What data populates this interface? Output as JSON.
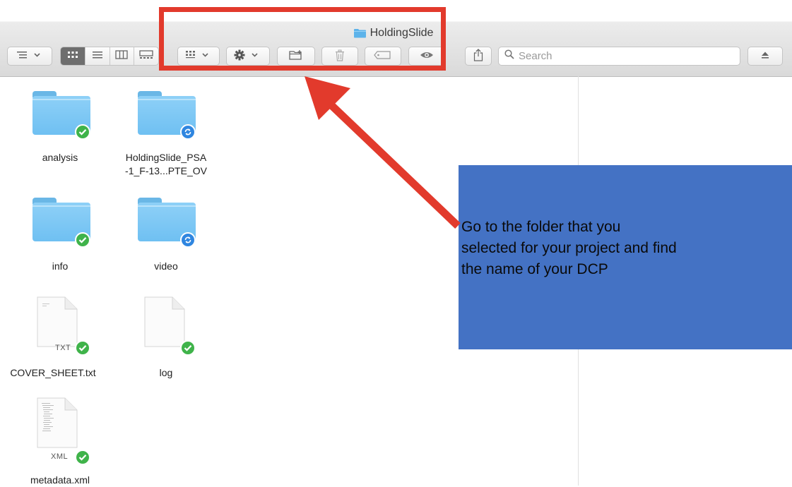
{
  "window": {
    "title": "HoldingSlide"
  },
  "toolbar": {
    "list_dropdown_icon": "list-view-dropdown-icon",
    "view_modes": [
      "icon-view-icon",
      "list-view-icon",
      "column-view-icon",
      "gallery-view-icon"
    ],
    "active_view": "icon-view-icon",
    "group_icon": "group-by-icon",
    "action_icon": "gear-icon",
    "new_folder_icon": "new-folder-icon",
    "delete_icon": "trash-icon",
    "tag_icon": "tag-icon",
    "quicklook_icon": "eye-icon",
    "share_icon": "share-icon",
    "eject_icon": "eject-icon",
    "search_placeholder": "Search"
  },
  "files": [
    {
      "name": "analysis",
      "kind": "folder",
      "status": "synced"
    },
    {
      "name": "HoldingSlide_PSA\n-1_F-13...PTE_OV",
      "kind": "folder",
      "status": "syncing"
    },
    {
      "name": "info",
      "kind": "folder",
      "status": "synced"
    },
    {
      "name": "video",
      "kind": "folder",
      "status": "syncing"
    },
    {
      "name": "COVER_SHEET.txt",
      "kind": "document",
      "type_label": "TXT",
      "status": "synced"
    },
    {
      "name": "log",
      "kind": "document",
      "type_label": "",
      "status": "synced"
    },
    {
      "name": "metadata.xml",
      "kind": "document",
      "type_label": "XML",
      "status": "synced"
    }
  ],
  "annotation": {
    "lines": [
      "Go to the folder that you",
      "selected for your project and find",
      "the name of your DCP"
    ],
    "box_color": "#4472c4",
    "arrow_color": "#e23a2c"
  },
  "colors": {
    "folder_blue": "#7dc8f5",
    "synced_badge": "#3fb34a",
    "syncing_badge": "#2f86e0"
  }
}
